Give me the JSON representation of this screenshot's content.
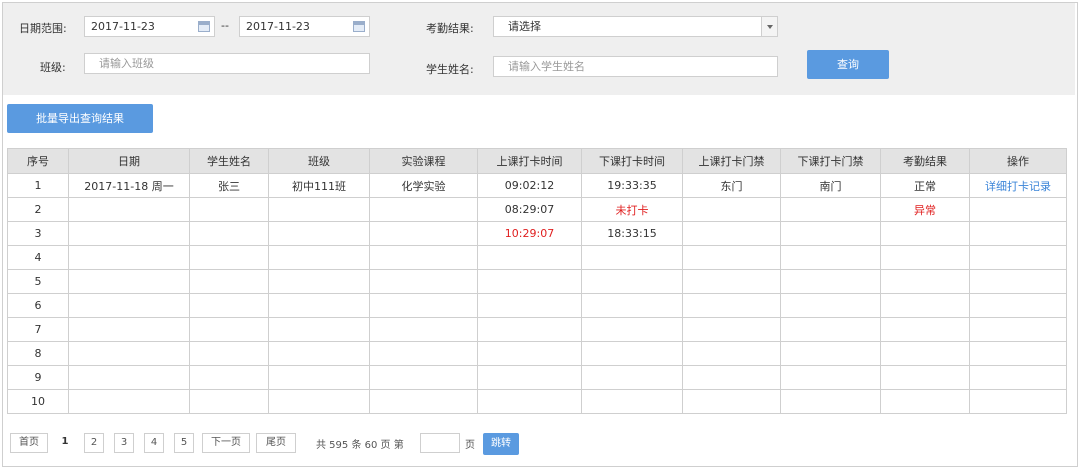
{
  "filters": {
    "date_range_label": "日期范围:",
    "date_start": "2017-11-23",
    "date_sep": "--",
    "date_end": "2017-11-23",
    "attendance_label": "考勤结果:",
    "attendance_value": "请选择",
    "class_label": "班级:",
    "class_placeholder": "请输入班级",
    "student_label": "学生姓名:",
    "student_placeholder": "请输入学生姓名",
    "query_button": "查询"
  },
  "export_button": "批量导出查询结果",
  "table": {
    "headers": [
      "序号",
      "日期",
      "学生姓名",
      "班级",
      "实验课程",
      "上课打卡时间",
      "下课打卡时间",
      "上课打卡门禁",
      "下课打卡门禁",
      "考勤结果",
      "操作"
    ],
    "rows": [
      [
        "1",
        "2017-11-18  周一",
        "张三",
        "初中111班",
        "化学实验",
        "09:02:12",
        "19:33:35",
        "东门",
        "南门",
        "正常",
        "详细打卡记录"
      ],
      [
        "2",
        "",
        "",
        "",
        "",
        "08:29:07",
        "未打卡",
        "",
        "",
        "异常",
        ""
      ],
      [
        "3",
        "",
        "",
        "",
        "",
        "10:29:07",
        "18:33:15",
        "",
        "",
        "",
        ""
      ],
      [
        "4",
        "",
        "",
        "",
        "",
        "",
        "",
        "",
        "",
        "",
        ""
      ],
      [
        "5",
        "",
        "",
        "",
        "",
        "",
        "",
        "",
        "",
        "",
        ""
      ],
      [
        "6",
        "",
        "",
        "",
        "",
        "",
        "",
        "",
        "",
        "",
        ""
      ],
      [
        "7",
        "",
        "",
        "",
        "",
        "",
        "",
        "",
        "",
        "",
        ""
      ],
      [
        "8",
        "",
        "",
        "",
        "",
        "",
        "",
        "",
        "",
        "",
        ""
      ],
      [
        "9",
        "",
        "",
        "",
        "",
        "",
        "",
        "",
        "",
        "",
        ""
      ],
      [
        "10",
        "",
        "",
        "",
        "",
        "",
        "",
        "",
        "",
        "",
        ""
      ]
    ]
  },
  "pagination": {
    "first": "首页",
    "pages": [
      "1",
      "2",
      "3",
      "4",
      "5"
    ],
    "current_page": "1",
    "next": "下一页",
    "last": "尾页",
    "total_text": "共 595 条  60 页 第",
    "page_unit": "页",
    "jump": "跳转"
  },
  "colors": {
    "accent": "#5a9ae0",
    "error": "#e02020",
    "link": "#3a84d8"
  }
}
